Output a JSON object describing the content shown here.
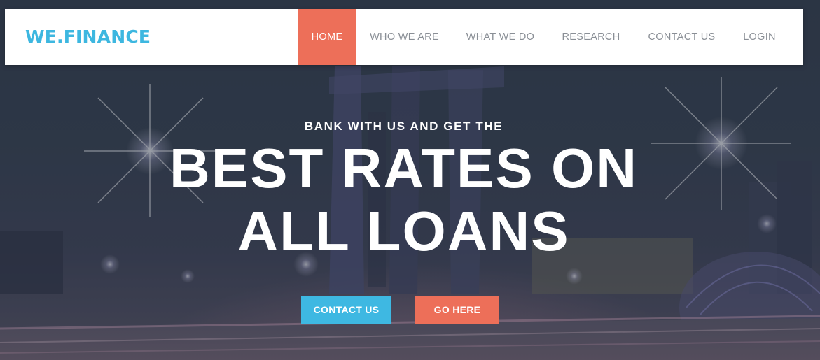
{
  "brand": {
    "name": "WE.FINANCE",
    "color": "#3db7e0"
  },
  "nav": {
    "items": [
      {
        "label": "HOME",
        "active": true
      },
      {
        "label": "WHO WE ARE",
        "active": false
      },
      {
        "label": "WHAT WE DO",
        "active": false
      },
      {
        "label": "RESEARCH",
        "active": false
      },
      {
        "label": "CONTACT US",
        "active": false
      },
      {
        "label": "LOGIN",
        "active": false
      }
    ],
    "active_color": "#ed6f59"
  },
  "hero": {
    "kicker": "BANK WITH US AND GET THE",
    "headline_line1": "BEST RATES ON",
    "headline_line2": "ALL LOANS",
    "buttons": {
      "contact_label": "CONTACT US",
      "go_label": "GO HERE"
    },
    "colors": {
      "primary": "#3eb8e2",
      "accent": "#ed6f59"
    }
  }
}
